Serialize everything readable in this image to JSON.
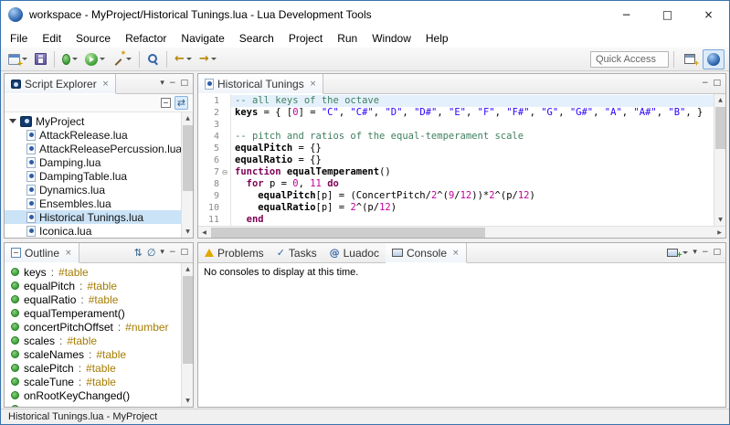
{
  "window": {
    "title": "workspace - MyProject/Historical Tunings.lua - Lua Development Tools",
    "status": "Historical Tunings.lua - MyProject"
  },
  "menus": [
    "File",
    "Edit",
    "Source",
    "Refactor",
    "Navigate",
    "Search",
    "Project",
    "Run",
    "Window",
    "Help"
  ],
  "toolbar": {
    "quick_access": "Quick Access"
  },
  "script_explorer": {
    "title": "Script Explorer",
    "project": "MyProject",
    "files": [
      "AttackRelease.lua",
      "AttackReleasePercussion.lua",
      "Damping.lua",
      "DampingTable.lua",
      "Dynamics.lua",
      "Ensembles.lua",
      "Historical Tunings.lua",
      "Iconica.lua"
    ],
    "selected": "Historical Tunings.lua"
  },
  "editor": {
    "tab": "Historical Tunings",
    "lines": [
      {
        "num": "1",
        "hl": true,
        "tokens": [
          [
            "c",
            "-- all keys of the octave"
          ]
        ]
      },
      {
        "num": "2",
        "tokens": [
          [
            "g",
            "keys"
          ],
          [
            "p",
            " = { ["
          ],
          [
            "n",
            "0"
          ],
          [
            "p",
            "] = "
          ],
          [
            "s",
            "\"C\""
          ],
          [
            "p",
            ", "
          ],
          [
            "s",
            "\"C#\""
          ],
          [
            "p",
            ", "
          ],
          [
            "s",
            "\"D\""
          ],
          [
            "p",
            ", "
          ],
          [
            "s",
            "\"D#\""
          ],
          [
            "p",
            ", "
          ],
          [
            "s",
            "\"E\""
          ],
          [
            "p",
            ", "
          ],
          [
            "s",
            "\"F\""
          ],
          [
            "p",
            ", "
          ],
          [
            "s",
            "\"F#\""
          ],
          [
            "p",
            ", "
          ],
          [
            "s",
            "\"G\""
          ],
          [
            "p",
            ", "
          ],
          [
            "s",
            "\"G#\""
          ],
          [
            "p",
            ", "
          ],
          [
            "s",
            "\"A\""
          ],
          [
            "p",
            ", "
          ],
          [
            "s",
            "\"A#\""
          ],
          [
            "p",
            ", "
          ],
          [
            "s",
            "\"B\""
          ],
          [
            "p",
            ", }"
          ]
        ]
      },
      {
        "num": "3",
        "tokens": []
      },
      {
        "num": "4",
        "tokens": [
          [
            "c",
            "-- pitch and ratios of the equal-temperament scale"
          ]
        ]
      },
      {
        "num": "5",
        "tokens": [
          [
            "g",
            "equalPitch"
          ],
          [
            "p",
            " = {}"
          ]
        ]
      },
      {
        "num": "6",
        "tokens": [
          [
            "g",
            "equalRatio"
          ],
          [
            "p",
            " = {}"
          ]
        ]
      },
      {
        "num": "7",
        "fold": true,
        "tokens": [
          [
            "k",
            "function"
          ],
          [
            "p",
            " "
          ],
          [
            "g",
            "equalTemperament"
          ],
          [
            "p",
            "()"
          ]
        ]
      },
      {
        "num": "8",
        "tokens": [
          [
            "p",
            "  "
          ],
          [
            "k",
            "for"
          ],
          [
            "p",
            " p = "
          ],
          [
            "n",
            "0"
          ],
          [
            "p",
            ", "
          ],
          [
            "n",
            "11"
          ],
          [
            "p",
            " "
          ],
          [
            "k",
            "do"
          ]
        ]
      },
      {
        "num": "9",
        "tokens": [
          [
            "p",
            "    "
          ],
          [
            "g",
            "equalPitch"
          ],
          [
            "p",
            "[p] = (ConcertPitch/"
          ],
          [
            "n",
            "2"
          ],
          [
            "p",
            "^("
          ],
          [
            "n",
            "9"
          ],
          [
            "p",
            "/"
          ],
          [
            "n",
            "12"
          ],
          [
            "p",
            "))*"
          ],
          [
            "n",
            "2"
          ],
          [
            "p",
            "^(p/"
          ],
          [
            "n",
            "12"
          ],
          [
            "p",
            ")"
          ]
        ]
      },
      {
        "num": "10",
        "tokens": [
          [
            "p",
            "    "
          ],
          [
            "g",
            "equalRatio"
          ],
          [
            "p",
            "[p] = "
          ],
          [
            "n",
            "2"
          ],
          [
            "p",
            "^(p/"
          ],
          [
            "n",
            "12"
          ],
          [
            "p",
            ")"
          ]
        ]
      },
      {
        "num": "11",
        "tokens": [
          [
            "p",
            "  "
          ],
          [
            "k",
            "end"
          ]
        ]
      }
    ]
  },
  "outline": {
    "title": "Outline",
    "items": [
      {
        "name": "keys",
        "type": "#table"
      },
      {
        "name": "equalPitch",
        "type": "#table"
      },
      {
        "name": "equalRatio",
        "type": "#table"
      },
      {
        "name": "equalTemperament()",
        "type": ""
      },
      {
        "name": "concertPitchOffset",
        "type": "#number"
      },
      {
        "name": "scales",
        "type": "#table"
      },
      {
        "name": "scaleNames",
        "type": "#table"
      },
      {
        "name": "scalePitch",
        "type": "#table"
      },
      {
        "name": "scaleTune",
        "type": "#table"
      },
      {
        "name": "onRootKeyChanged()",
        "type": ""
      },
      {
        "name": "",
        "type": ""
      }
    ]
  },
  "console": {
    "tabs": [
      "Problems",
      "Tasks",
      "Luadoc",
      "Console"
    ],
    "active": "Console",
    "message": "No consoles to display at this time."
  },
  "icons": {
    "window_minimize": "−",
    "window_maximize": "□",
    "window_close": "×",
    "tab_close": "×",
    "view_menu": "▾",
    "panel_minimize": "−",
    "panel_maximize": "□",
    "link_editor": "⇄",
    "sort": "⇅",
    "filter": "∅",
    "back": "←",
    "forward": "→",
    "fold_minus": "⊖",
    "scroll_up": "▲",
    "scroll_down": "▼",
    "scroll_left": "◀",
    "scroll_right": "▶",
    "tasks_check": "✓",
    "luadoc_at": "@"
  }
}
